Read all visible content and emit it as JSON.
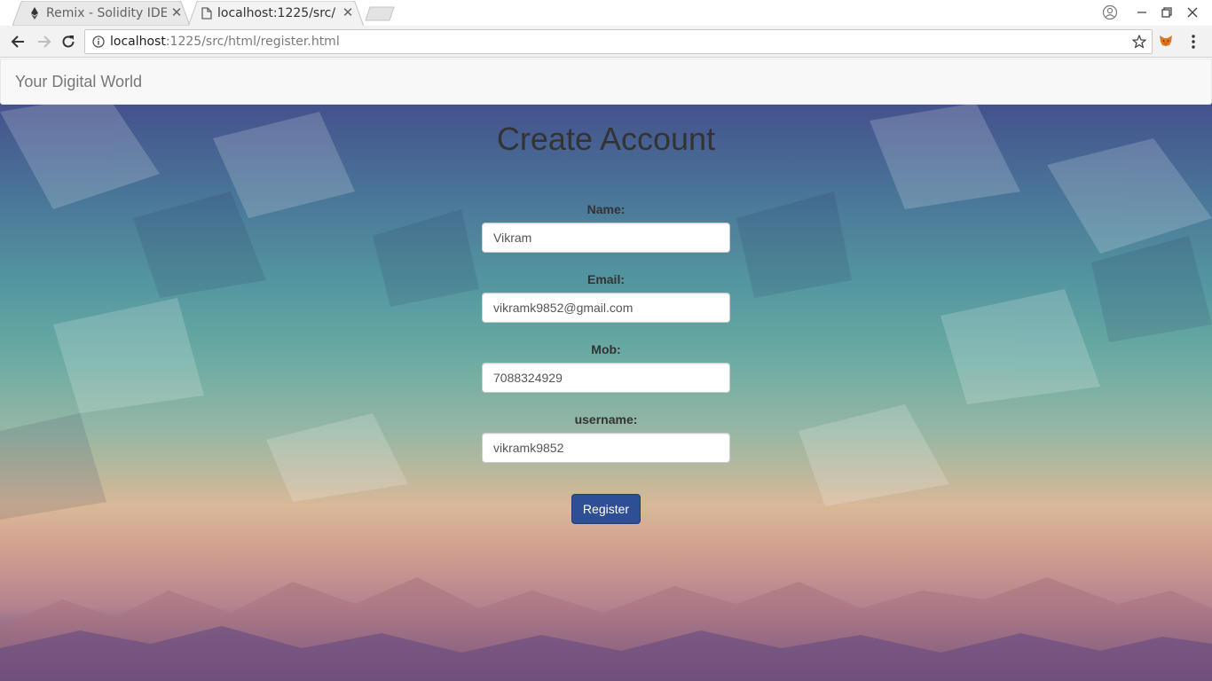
{
  "browser": {
    "tabs": [
      {
        "title": "Remix - Solidity IDE",
        "favicon": "ethereum-icon",
        "active": false
      },
      {
        "title": "localhost:1225/src/",
        "favicon": "page-icon",
        "active": true
      }
    ],
    "url": {
      "host": "localhost",
      "path": ":1225/src/html/register.html"
    },
    "icons": {
      "back": "back-arrow-icon",
      "forward": "forward-arrow-icon",
      "reload": "reload-icon",
      "info": "info-icon",
      "bookmark": "star-icon",
      "extension": "metamask-fox-icon",
      "menu": "kebab-menu-icon",
      "profile": "profile-icon",
      "minimize": "minimize-icon",
      "restore": "restore-icon",
      "close": "close-icon"
    }
  },
  "navbar": {
    "brand": "Your Digital World"
  },
  "form": {
    "title": "Create Account",
    "fields": [
      {
        "label": "Name:",
        "value": "Vikram"
      },
      {
        "label": "Email:",
        "value": "vikramk9852@gmail.com"
      },
      {
        "label": "Mob:",
        "value": "7088324929"
      },
      {
        "label": "username:",
        "value": "vikramk9852"
      }
    ],
    "submit_label": "Register"
  },
  "colors": {
    "button": "#2f4f94",
    "navbar_bg": "#f8f8f8",
    "bg_top": "#3f3f86",
    "bg_middle": "#5496a0",
    "bg_sunset": "#d9b897",
    "bg_bottom": "#4a3466"
  }
}
